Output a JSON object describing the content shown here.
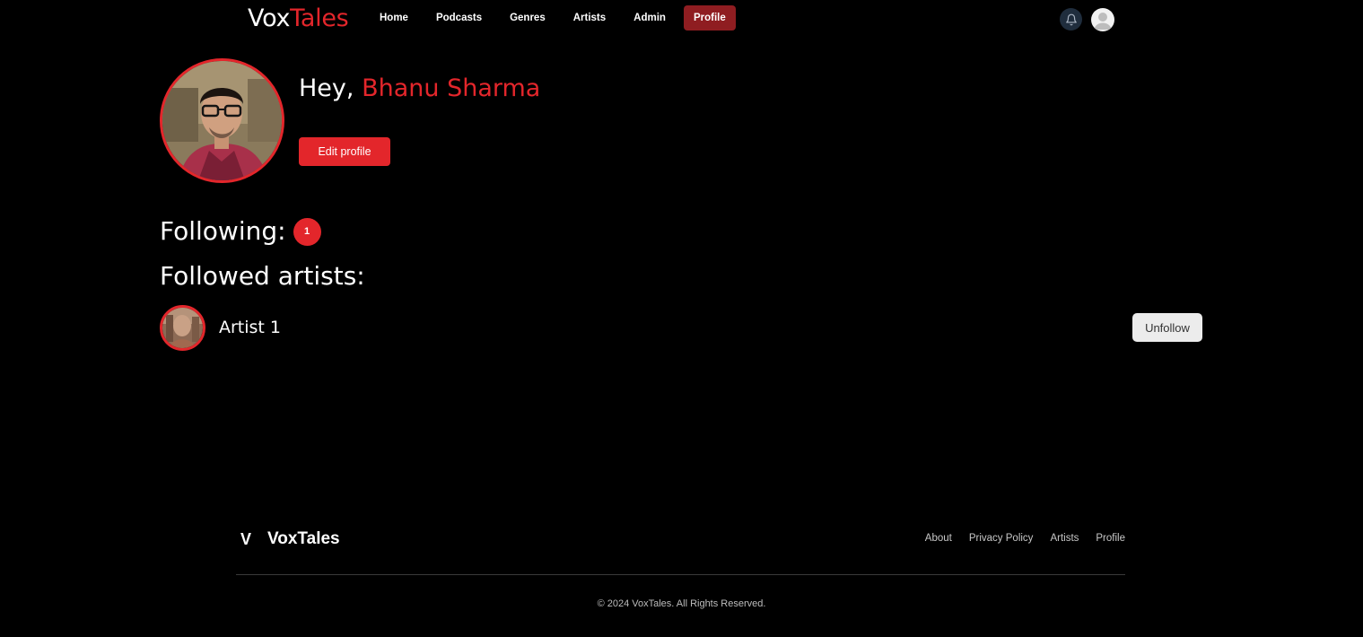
{
  "brand": {
    "part1": "Vox",
    "part2": "Tales"
  },
  "nav": {
    "links": [
      {
        "label": "Home"
      },
      {
        "label": "Podcasts"
      },
      {
        "label": "Genres"
      },
      {
        "label": "Artists"
      },
      {
        "label": "Admin"
      },
      {
        "label": "Profile",
        "active": true
      }
    ],
    "icons": {
      "notifications": "bell-icon",
      "user": "user-avatar"
    }
  },
  "profile": {
    "greeting": "Hey,",
    "name": "Bhanu Sharma",
    "edit_label": "Edit profile"
  },
  "following": {
    "label": "Following:",
    "count": "1"
  },
  "followed_artists": {
    "title": "Followed artists:",
    "items": [
      {
        "name": "Artist 1",
        "action_label": "Unfollow"
      }
    ]
  },
  "footer": {
    "logo_letter": "V",
    "brand": "VoxTales",
    "links": [
      "About",
      "Privacy Policy",
      "Artists",
      "Profile"
    ],
    "copyright": "© 2024 VoxTales. All Rights Reserved."
  },
  "colors": {
    "accent": "#e3262b",
    "active_nav": "#8f1d21",
    "background": "#000000"
  }
}
